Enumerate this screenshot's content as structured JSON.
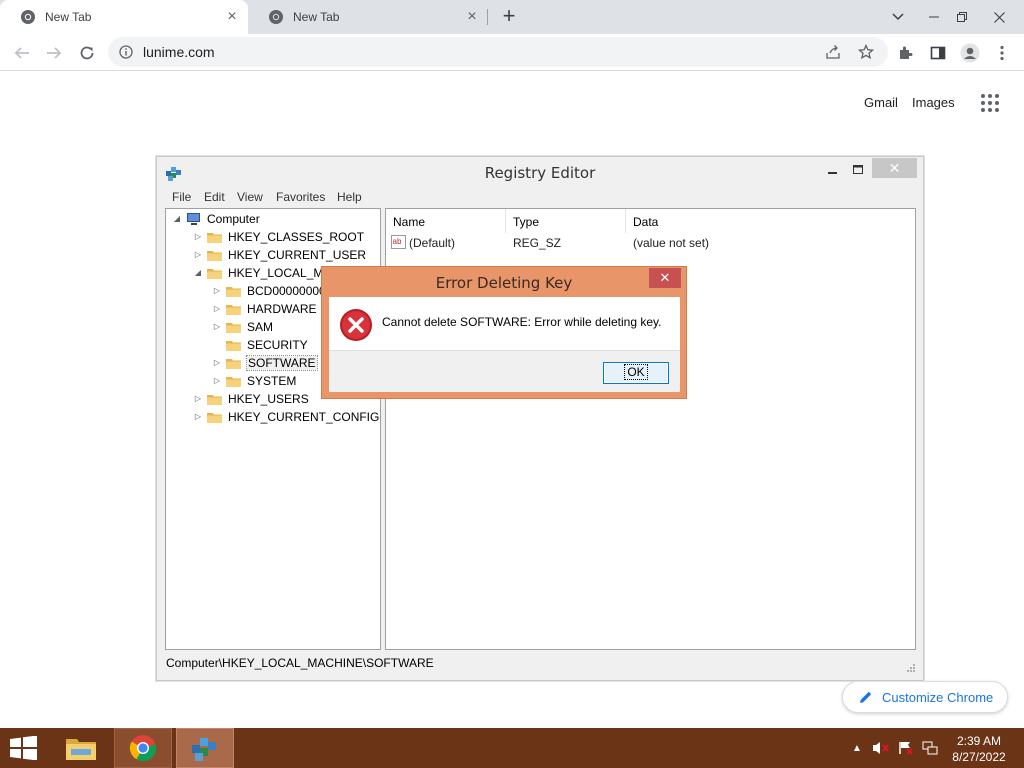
{
  "browser": {
    "tabs": [
      {
        "title": "New Tab",
        "active": true
      },
      {
        "title": "New Tab",
        "active": false
      }
    ],
    "url": "lunime.com",
    "ntp": {
      "links": [
        "Gmail",
        "Images"
      ],
      "customize_label": "Customize Chrome"
    }
  },
  "regedit": {
    "title": "Registry Editor",
    "menu": [
      "File",
      "Edit",
      "View",
      "Favorites",
      "Help"
    ],
    "tree": {
      "root": "Computer",
      "hives": [
        "HKEY_CLASSES_ROOT",
        "HKEY_CURRENT_USER",
        "HKEY_LOCAL_MA",
        "HKEY_USERS",
        "HKEY_CURRENT_CONFIG"
      ],
      "hklm_children": [
        "BCD00000000",
        "HARDWARE",
        "SAM",
        "SECURITY",
        "SOFTWARE",
        "SYSTEM"
      ],
      "selected": "SOFTWARE"
    },
    "columns": [
      "Name",
      "Type",
      "Data"
    ],
    "values": [
      {
        "name": "(Default)",
        "type": "REG_SZ",
        "data": "(value not set)"
      }
    ],
    "status_path": "Computer\\HKEY_LOCAL_MACHINE\\SOFTWARE"
  },
  "error_dialog": {
    "title": "Error Deleting Key",
    "message": "Cannot delete SOFTWARE:  Error while deleting key.",
    "ok_label": "OK"
  },
  "taskbar": {
    "time": "2:39 AM",
    "date": "8/27/2022"
  },
  "colors": {
    "dialog_frame": "#e9956a",
    "taskbar": "#6b3416",
    "link_blue": "#1a73e8",
    "error_red": "#c0272d"
  },
  "icons": [
    "chrome-favicon",
    "close-icon",
    "plus-icon",
    "chevron-down-icon",
    "minimize-icon",
    "restore-icon",
    "back-arrow-icon",
    "forward-arrow-icon",
    "reload-icon",
    "info-icon",
    "share-icon",
    "star-icon",
    "puzzle-icon",
    "sidepanel-icon",
    "profile-icon",
    "kebab-menu-icon",
    "apps-grid-icon",
    "pencil-icon",
    "regedit-icon",
    "folder-icon",
    "string-value-icon",
    "error-icon",
    "windows-start-icon",
    "file-explorer-icon",
    "speaker-muted-icon",
    "flag-icon",
    "network-icon"
  ]
}
